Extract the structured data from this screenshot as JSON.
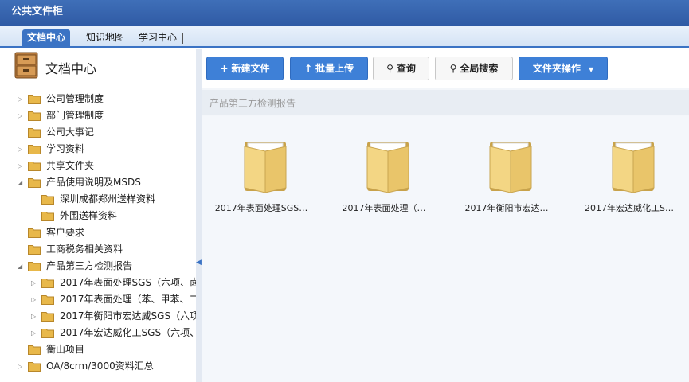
{
  "window": {
    "title": "公共文件柜"
  },
  "tabs": [
    {
      "label": "文档中心",
      "active": true
    },
    {
      "label": "知识地图",
      "active": false
    },
    {
      "label": "学习中心",
      "active": false
    }
  ],
  "sidebar": {
    "title": "文档中心",
    "items": [
      {
        "label": "公司管理制度",
        "arrow": "▷"
      },
      {
        "label": "部门管理制度",
        "arrow": "▷"
      },
      {
        "label": "公司大事记",
        "arrow": ""
      },
      {
        "label": "学习资料",
        "arrow": "▷"
      },
      {
        "label": "共享文件夹",
        "arrow": "▷"
      },
      {
        "label": "产品使用说明及MSDS",
        "arrow": "◢"
      },
      {
        "label": "深圳成都郑州送样资料",
        "arrow": ""
      },
      {
        "label": "外围送样资料",
        "arrow": ""
      },
      {
        "label": "客户要求",
        "arrow": ""
      },
      {
        "label": "工商税务相关资料",
        "arrow": ""
      },
      {
        "label": "产品第三方检测报告",
        "arrow": "◢"
      },
      {
        "label": "2017年表面处理SGS（六项、卤",
        "arrow": "▷"
      },
      {
        "label": "2017年表面处理（苯、甲苯、二",
        "arrow": "▷"
      },
      {
        "label": "2017年衡阳市宏达威SGS（六项",
        "arrow": "▷"
      },
      {
        "label": "2017年宏达威化工SGS（六项、",
        "arrow": "▷"
      },
      {
        "label": "衡山项目",
        "arrow": ""
      },
      {
        "label": "OA/8crm/3000资料汇总",
        "arrow": "▷"
      }
    ]
  },
  "toolbar": {
    "new_file": "新建文件",
    "batch_upload": "批量上传",
    "query": "查询",
    "global_search": "全局搜索",
    "folder_ops": "文件夹操作"
  },
  "breadcrumb": "产品第三方检测报告",
  "files": [
    {
      "name": "2017年表面处理SGS…"
    },
    {
      "name": "2017年表面处理（…"
    },
    {
      "name": "2017年衡阳市宏达…"
    },
    {
      "name": "2017年宏达威化工S…"
    }
  ],
  "colors": {
    "accent": "#3b73c4",
    "titlebar": "#2f5aa4",
    "folder": "#e8b84a"
  }
}
